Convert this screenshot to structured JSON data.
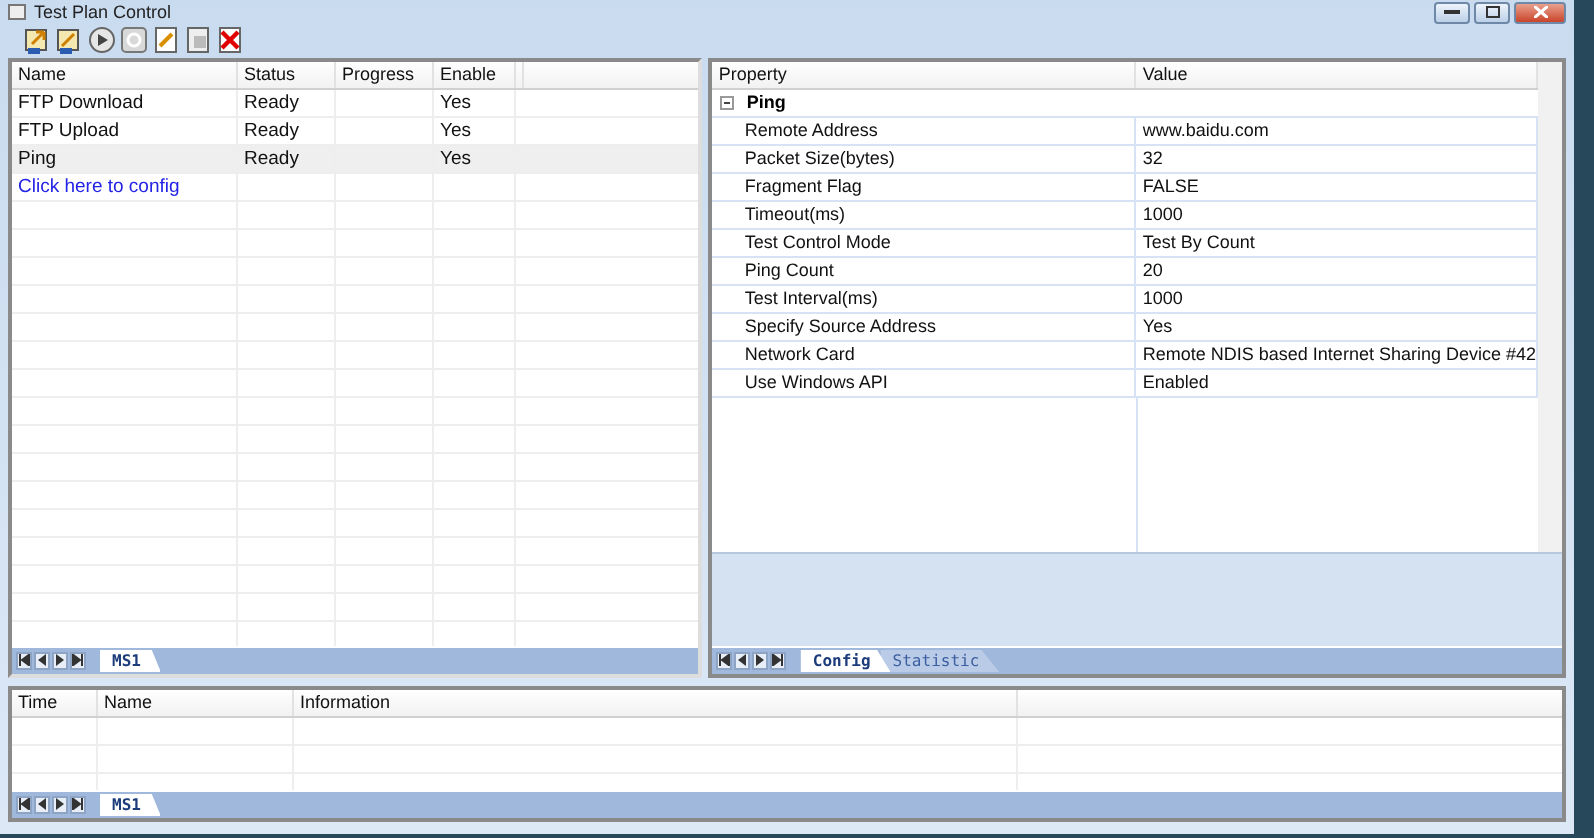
{
  "window": {
    "title": "Test Plan Control"
  },
  "test_plans": {
    "columns": [
      "Name",
      "Status",
      "Progress",
      "Enable"
    ],
    "rows": [
      {
        "name": "FTP Download",
        "status": "Ready",
        "enable": "Yes",
        "selected": false
      },
      {
        "name": "FTP Upload",
        "status": "Ready",
        "enable": "Yes",
        "selected": false
      },
      {
        "name": "Ping",
        "status": "Ready",
        "enable": "Yes",
        "selected": true
      }
    ],
    "config_link": "Click here to config",
    "tabs": [
      {
        "label": "MS1",
        "selected": true
      }
    ]
  },
  "properties": {
    "columns": [
      "Property",
      "Value"
    ],
    "group": {
      "label": "Ping",
      "expanded": true,
      "items": [
        {
          "property": "Remote Address",
          "value": "www.baidu.com"
        },
        {
          "property": "Packet Size(bytes)",
          "value": "32"
        },
        {
          "property": "Fragment Flag",
          "value": "FALSE"
        },
        {
          "property": "Timeout(ms)",
          "value": "1000"
        },
        {
          "property": "Test Control Mode",
          "value": "Test By Count"
        },
        {
          "property": "Ping Count",
          "value": "20"
        },
        {
          "property": "Test Interval(ms)",
          "value": "1000"
        },
        {
          "property": "Specify Source Address",
          "value": "Yes"
        },
        {
          "property": "Network Card",
          "value": "Remote NDIS based Internet Sharing Device #42"
        },
        {
          "property": "Use Windows API",
          "value": "Enabled"
        }
      ]
    },
    "tabs": [
      {
        "label": "Config",
        "selected": true
      },
      {
        "label": "Statistic",
        "selected": false
      }
    ]
  },
  "log": {
    "columns": [
      "Time",
      "Name",
      "Information"
    ],
    "tabs": [
      {
        "label": "MS1",
        "selected": true
      }
    ]
  }
}
